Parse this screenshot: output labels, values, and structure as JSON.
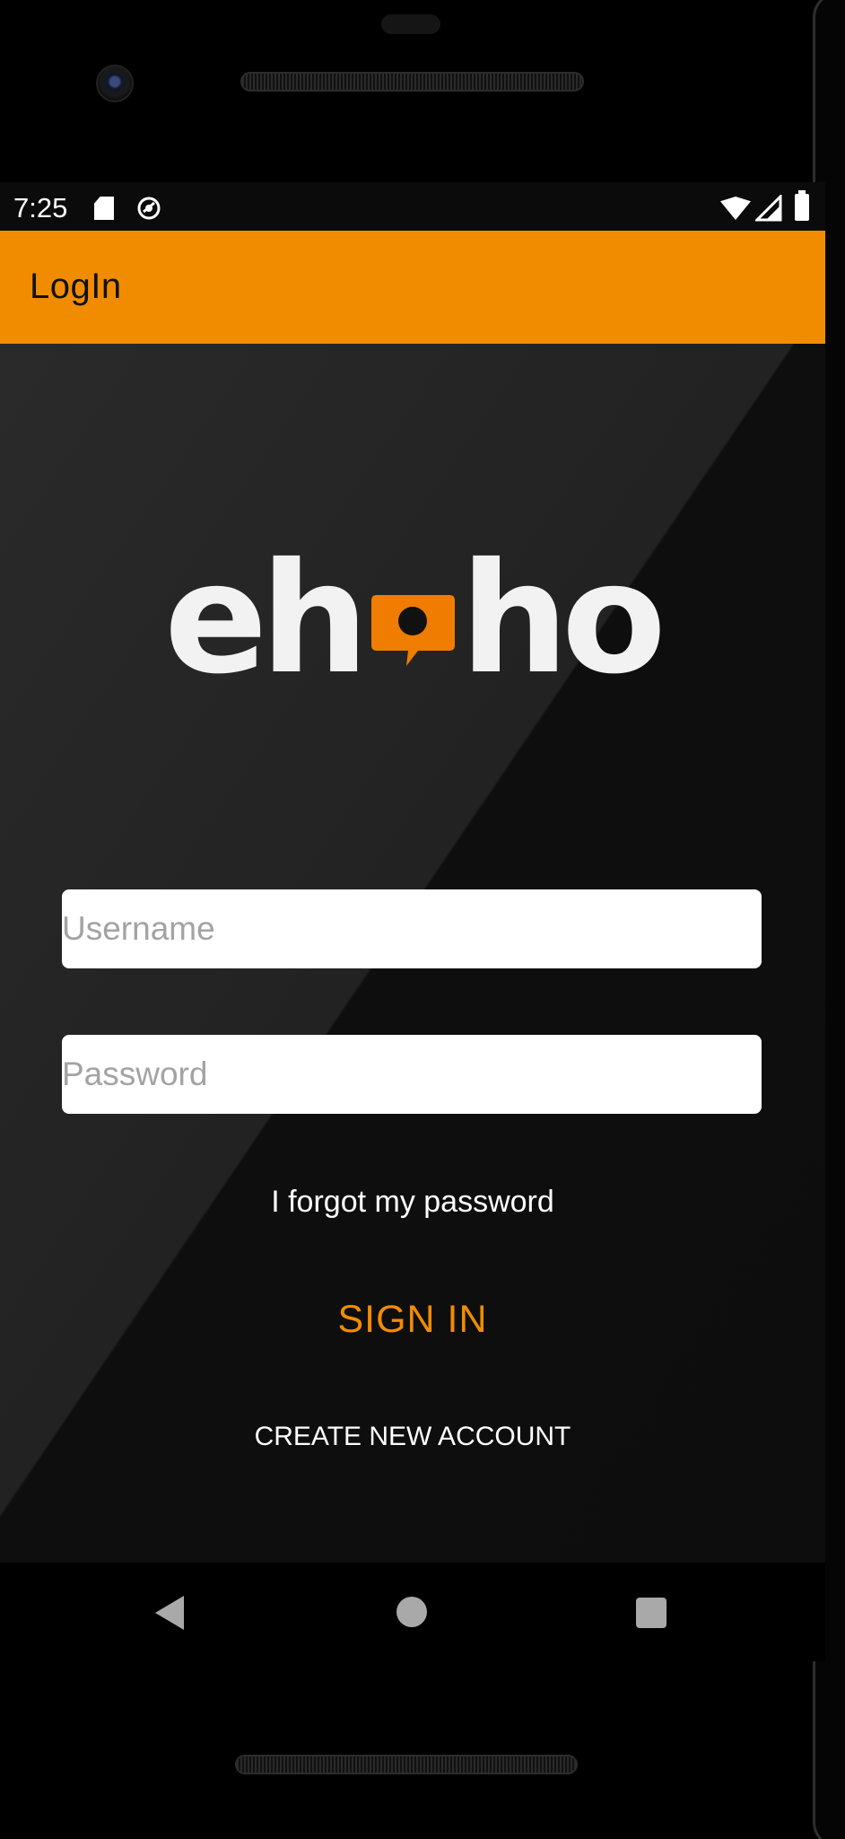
{
  "status_bar": {
    "time": "7:25",
    "icons": [
      "sd-card-icon",
      "sync-icon",
      "wifi-icon",
      "signal-icon",
      "battery-icon"
    ]
  },
  "app_bar": {
    "title": "LogIn",
    "color": "#f18c00"
  },
  "logo": {
    "text_left": "eh",
    "text_right": "ho",
    "icon": "speech-bubble-icon"
  },
  "form": {
    "username_placeholder": "Username",
    "password_placeholder": "Password",
    "forgot_label": "I forgot my password",
    "signin_label": "SIGN IN",
    "create_label": "CREATE NEW ACCOUNT"
  },
  "nav_bar": {
    "icons": [
      "back-icon",
      "home-icon",
      "recents-icon"
    ]
  },
  "colors": {
    "accent": "#f18c00",
    "background": "#1f1f1f"
  }
}
